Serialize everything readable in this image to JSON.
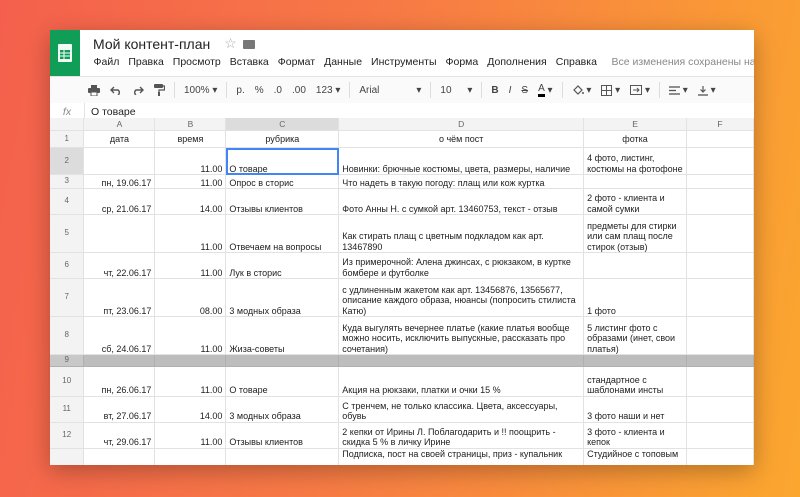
{
  "doc": {
    "title": "Мой контент-план",
    "star_glyph": "☆"
  },
  "menu": [
    "Файл",
    "Правка",
    "Просмотр",
    "Вставка",
    "Формат",
    "Данные",
    "Инструменты",
    "Форма",
    "Дополнения",
    "Справка"
  ],
  "saved_status": "Все изменения сохранены на Диске",
  "toolbar": {
    "zoom": "100%",
    "currency": "р.",
    "percent": "%",
    "dec_dec": ".0",
    "inc_dec": ".00",
    "format": "123",
    "font": "Arial",
    "size": "10",
    "bold": "B",
    "italic": "I",
    "strike": "S",
    "text_color": "A"
  },
  "formula": {
    "fx": "fx",
    "value": "О товаре"
  },
  "columns": [
    "A",
    "B",
    "C",
    "D",
    "E",
    "F"
  ],
  "rows": [
    {
      "n": "1",
      "a": "дата",
      "b": "время",
      "c": "рубрика",
      "d": "о чём пост",
      "e": "фотка",
      "f": ""
    },
    {
      "n": "2",
      "a": "",
      "b": "11.00",
      "c": "О товаре",
      "d": "Новинки: брючные костюмы, цвета, размеры, наличие",
      "e": "4 фото, листинг, костюмы на фотофоне",
      "f": ""
    },
    {
      "n": "3",
      "a": "пн, 19.06.17",
      "b": "11.00",
      "c": "Опрос в сторис",
      "d": "Что надеть в такую погоду: плащ или кож куртка",
      "e": "",
      "f": ""
    },
    {
      "n": "4",
      "a": "ср, 21.06.17",
      "b": "14.00",
      "c": "Отзывы клиентов",
      "d": "Фото Анны Н. с сумкой арт. 13460753, текст - отзыв",
      "e": "2 фото - клиента и самой сумки",
      "f": ""
    },
    {
      "n": "5",
      "a": "",
      "b": "11.00",
      "c": "Отвечаем на вопросы",
      "d": "Как стирать плащ с цветным подкладом как арт. 13467890",
      "e": "предметы для стирки или сам плащ после стирок (отзыв)",
      "f": ""
    },
    {
      "n": "6",
      "a": "чт, 22.06.17",
      "b": "11.00",
      "c": "Лук в сторис",
      "d": "Из примерочной: Алена джинсах, с рюкзаком, в куртке бомбере и футболке",
      "e": "",
      "f": ""
    },
    {
      "n": "7",
      "a": "пт, 23.06.17",
      "b": "08.00",
      "c": "3 модных образа",
      "d": "с удлиненным жакетом как арт. 13456876, 13565677, описание каждого образа, нюансы (попросить стилиста Катю)",
      "e": "1 фото",
      "f": ""
    },
    {
      "n": "8",
      "a": "сб, 24.06.17",
      "b": "11.00",
      "c": "Жиза-советы",
      "d": "Куда выгулять вечернее платье (какие платья вообще можно носить, исключить выпускные, рассказать про сочетания)",
      "e": "5 листинг фото с образами (инет, свои платья)",
      "f": ""
    },
    {
      "n": "9",
      "a": "",
      "b": "",
      "c": "",
      "d": "",
      "e": "",
      "f": ""
    },
    {
      "n": "10",
      "a": "пн, 26.06.17",
      "b": "11.00",
      "c": "О товаре",
      "d": "Акция на рюкзаки, платки и очки 15 %",
      "e": "стандартное с шаблонами инсты",
      "f": ""
    },
    {
      "n": "11",
      "a": "вт, 27.06.17",
      "b": "14.00",
      "c": "3 модных образа",
      "d": "С тренчем, не только классика. Цвета, аксессуары, обувь",
      "e": "3 фото наши и нет",
      "f": ""
    },
    {
      "n": "12",
      "a": "чт, 29.06.17",
      "b": "11.00",
      "c": "Отзывы клиентов",
      "d": "2 кепки от Ирины Л. Поблагодарить и !! поощрить - скидка 5 % в личку Ирине",
      "e": "3 фото - клиента и кепок",
      "f": ""
    },
    {
      "n": "",
      "a": "",
      "b": "",
      "c": "",
      "d": "Подписка, пост на своей страницы, приз - купальник",
      "e": "Студийное с топовым",
      "f": ""
    }
  ]
}
